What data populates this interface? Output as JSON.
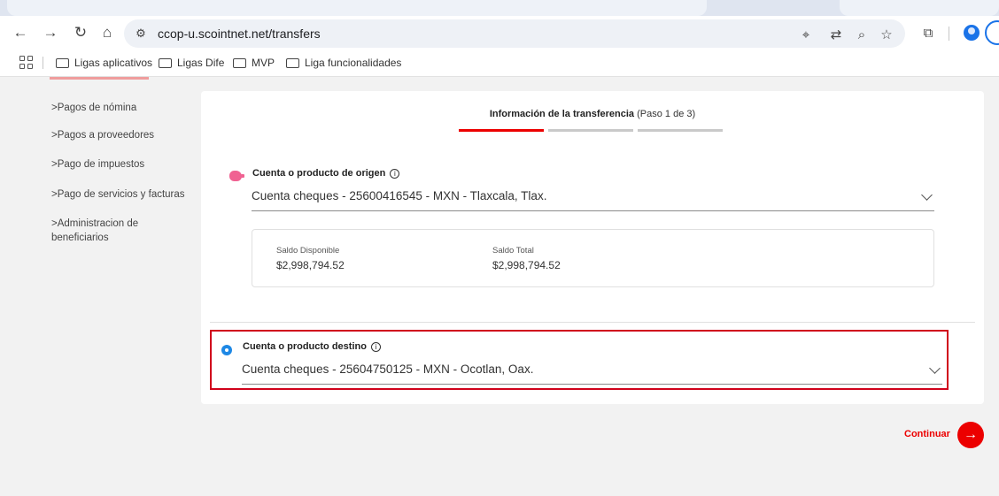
{
  "browser": {
    "url": "ccop-u.scointnet.net/transfers",
    "icons": {
      "back": "back-arrow-icon",
      "forward": "forward-arrow-icon",
      "reload": "reload-icon",
      "home": "home-icon",
      "site_settings": "tune-icon",
      "location": "location-pin-icon",
      "translate": "translate-icon",
      "zoom": "zoom-icon",
      "bookmark": "star-icon",
      "extensions": "puzzle-icon",
      "profile": "profile-icon",
      "menu": "menu-icon"
    },
    "bookmarks": [
      {
        "label": "Ligas aplicativos"
      },
      {
        "label": "Ligas Dife"
      },
      {
        "label": "MVP"
      },
      {
        "label": "Liga funcionalidades"
      }
    ]
  },
  "sidebar": {
    "items": [
      {
        "label": "Pagos de nómina"
      },
      {
        "label": "Pagos a proveedores"
      },
      {
        "label": "Pago de impuestos"
      },
      {
        "label": "Pago de servicios y facturas"
      },
      {
        "label": "Administracion de beneficiarios",
        "line1": "Administracion de",
        "line2": "beneficiarios"
      }
    ]
  },
  "stepper": {
    "title": "Información de la transferencia",
    "step_info": "(Paso 1 de 3)",
    "steps_total": 3,
    "current_step": 1
  },
  "origin": {
    "label": "Cuenta o producto de origen",
    "selected": "Cuenta cheques - 25600416545 - MXN - Tlaxcala, Tlax.",
    "balance_available_label": "Saldo Disponible",
    "balance_available": "$2,998,794.52",
    "balance_total_label": "Saldo Total",
    "balance_total": "$2,998,794.52"
  },
  "destination": {
    "label": "Cuenta o producto destino",
    "selected": "Cuenta cheques - 25604750125 - MXN - Ocotlan, Oax."
  },
  "actions": {
    "continue_label": "Continuar"
  },
  "colors": {
    "accent": "#ec0000",
    "highlight_border": "#d0021b",
    "origin_icon": "#f06292",
    "destination_icon": "#1e88e5"
  }
}
